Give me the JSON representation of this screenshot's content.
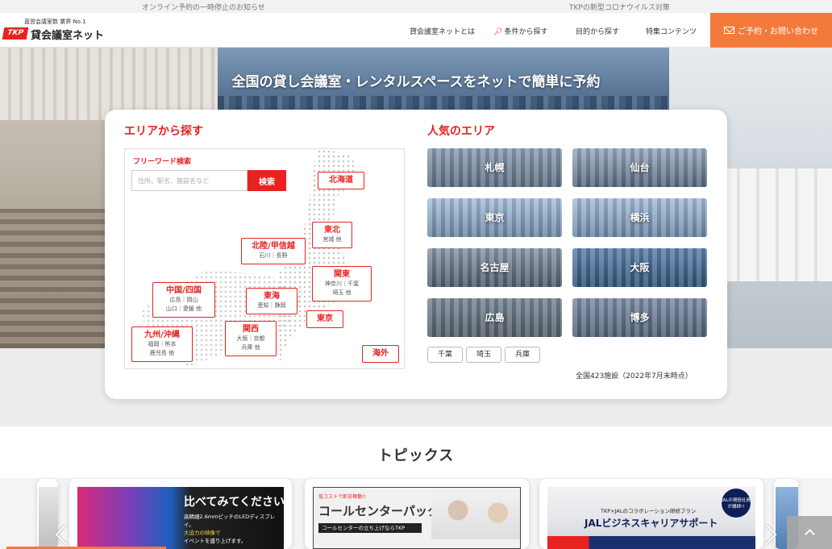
{
  "notices": [
    "オンライン予約の一時停止のお知らせ",
    "TKPの新型コロナウイルス対策"
  ],
  "header": {
    "logo_tagline": "直営会議室数 業界 No.1",
    "logo_mark": "TKP",
    "logo_text": "貸会議室ネット",
    "nav": {
      "about": "貸会議室ネットとは",
      "search_by_condition": "条件から探す",
      "search_by_purpose": "目的から探す",
      "feature": "特集コンテンツ"
    },
    "contact": "ご予約・お問い合わせ"
  },
  "hero": {
    "title": "全国の貸し会議室・レンタルスペースをネットで簡単に予約"
  },
  "area_search": {
    "heading": "エリアから探す",
    "freeword_label": "フリーワード検索",
    "search_placeholder": "住所、駅名、施設名など",
    "search_button": "検索",
    "regions": {
      "hokkaido": {
        "name": "北海道"
      },
      "tohoku": {
        "name": "東北",
        "sub": "宮城 他"
      },
      "hokuriku": {
        "name": "北陸/甲信越",
        "sub": "石川｜長野"
      },
      "kanto": {
        "name": "関東",
        "sub1": "神奈川｜千葉",
        "sub2": "埼玉 他"
      },
      "tokai": {
        "name": "東海",
        "sub": "愛知｜静岡"
      },
      "chugoku": {
        "name": "中国/四国",
        "sub1": "広島｜岡山",
        "sub2": "山口｜愛媛 他"
      },
      "tokyo": {
        "name": "東京"
      },
      "kansai": {
        "name": "関西",
        "sub1": "大阪｜京都",
        "sub2": "兵庫 他"
      },
      "kyushu": {
        "name": "九州/沖縄",
        "sub1": "福岡｜熊本",
        "sub2": "鹿児島 他"
      },
      "overseas": {
        "name": "海外"
      }
    }
  },
  "popular": {
    "heading": "人気のエリア",
    "tiles": {
      "sapporo": "札幌",
      "sendai": "仙台",
      "tokyo": "東京",
      "yokohama": "横浜",
      "nagoya": "名古屋",
      "osaka": "大阪",
      "hiroshima": "広島",
      "hakata": "博多"
    },
    "small": {
      "chiba": "千葉",
      "saitama": "埼玉",
      "hyogo": "兵庫"
    },
    "facility_note": "全国423施設（2022年7月末時点）"
  },
  "topics": {
    "title": "トピックス",
    "banner1": {
      "headline": "比べてみてください。",
      "line1": "高精細2.6mmピッチのLEDディスプレイ。",
      "line2": "大迫力の映像で",
      "line3": "イベントを盛り上げます。"
    },
    "banner2": {
      "tag": "低コストで即日稼働!!",
      "title": "コールセンターパック",
      "bar": "コールセンターの立ち上げならTKP"
    },
    "banner3": {
      "badge": "JALの現役社員が講師!!",
      "caption": "TKP×JALのコラボレーション研修プラン",
      "title": "JALビジネスキャリアサポート"
    }
  },
  "colors": {
    "brand_red": "#e8231f",
    "contact_orange": "#f47a3c"
  },
  "icons": [
    "mail-icon",
    "search-icon",
    "chevron-left-icon",
    "chevron-right-icon",
    "arrow-up-icon"
  ]
}
